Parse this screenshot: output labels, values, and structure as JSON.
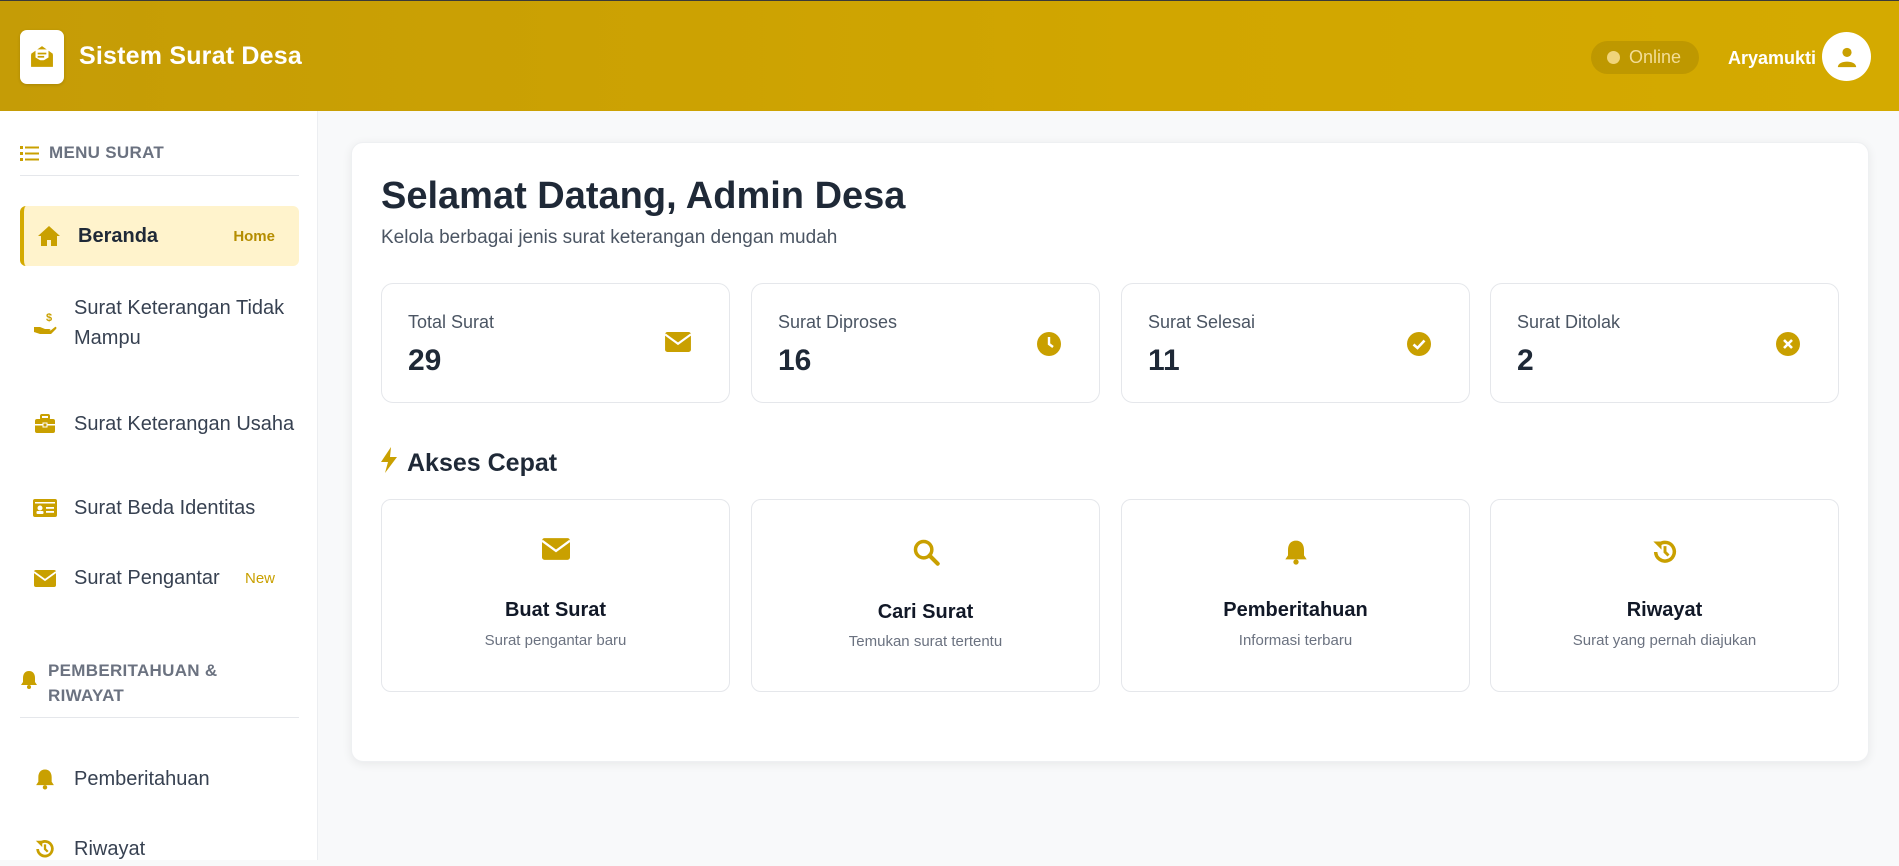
{
  "header": {
    "app_title": "Sistem Surat Desa",
    "status": "Online",
    "username": "Aryamukti",
    "logo_icon": "envelope-open-icon",
    "avatar_icon": "user-icon"
  },
  "colors": {
    "accent": "#c9a000",
    "header_bg": "#d1a600",
    "active_bg": "#fff3cc"
  },
  "sidebar": {
    "section_menu": "MENU SURAT",
    "items": [
      {
        "label": "Beranda",
        "badge": "Home",
        "icon": "home-icon"
      },
      {
        "label": "Surat Keterangan Tidak Mampu",
        "icon": "hand-money-icon"
      },
      {
        "label": "Surat Keterangan Usaha",
        "icon": "briefcase-icon"
      },
      {
        "label": "Surat Beda Identitas",
        "icon": "id-card-icon"
      },
      {
        "label": "Surat Pengantar",
        "badge": "New",
        "icon": "envelope-icon"
      }
    ],
    "section_notif": "PEMBERITAHUAN & RIWAYAT",
    "items2": [
      {
        "label": "Pemberitahuan",
        "icon": "bell-icon"
      },
      {
        "label": "Riwayat",
        "icon": "history-icon"
      }
    ]
  },
  "main": {
    "title": "Selamat Datang, Admin Desa",
    "subtitle": "Kelola berbagai jenis surat keterangan dengan mudah",
    "stats": [
      {
        "label": "Total Surat",
        "value": "29",
        "icon": "envelope-icon"
      },
      {
        "label": "Surat Diproses",
        "value": "16",
        "icon": "clock-icon"
      },
      {
        "label": "Surat Selesai",
        "value": "11",
        "icon": "check-circle-icon"
      },
      {
        "label": "Surat Ditolak",
        "value": "2",
        "icon": "x-circle-icon"
      }
    ],
    "quick_title": "Akses Cepat",
    "quick": [
      {
        "name": "Buat Surat",
        "desc": "Surat pengantar baru",
        "icon": "envelope-icon"
      },
      {
        "name": "Cari Surat",
        "desc": "Temukan surat tertentu",
        "icon": "search-icon"
      },
      {
        "name": "Pemberitahuan",
        "desc": "Informasi terbaru",
        "icon": "bell-icon"
      },
      {
        "name": "Riwayat",
        "desc": "Surat yang pernah diajukan",
        "icon": "history-icon"
      }
    ]
  }
}
